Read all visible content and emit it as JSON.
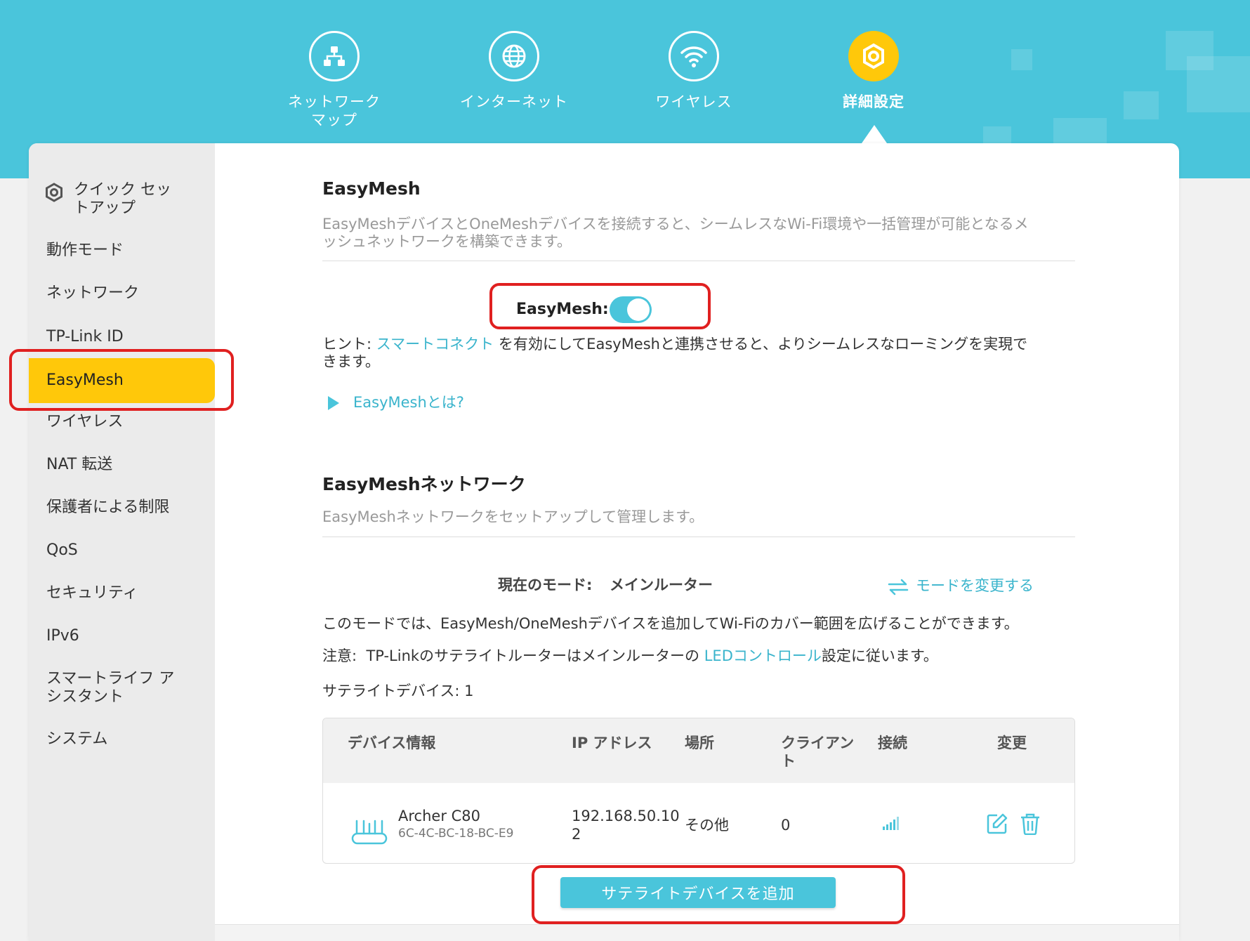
{
  "header": {
    "nav": [
      {
        "label_1": "ネットワーク",
        "label_2": "マップ",
        "icon": "network-map-icon",
        "active": false
      },
      {
        "label_1": "インターネット",
        "label_2": "",
        "icon": "globe-icon",
        "active": false
      },
      {
        "label_1": "ワイヤレス",
        "label_2": "",
        "icon": "wifi-icon",
        "active": false
      },
      {
        "label_1": "詳細設定",
        "label_2": "",
        "icon": "gear-icon",
        "active": true
      }
    ]
  },
  "sidebar": {
    "quick_setup_1": "クイック セッ",
    "quick_setup_2": "トアップ",
    "items": [
      "動作モード",
      "ネットワーク",
      "TP-Link ID",
      "EasyMesh",
      "ワイヤレス",
      "NAT 転送",
      "保護者による制限",
      "QoS",
      "セキュリティ",
      "IPv6",
      "スマートライフ ア",
      "シスタント",
      "システム"
    ]
  },
  "easymesh": {
    "title": "EasyMesh",
    "desc_1": "EasyMeshデバイスとOneMeshデバイスを接続すると、シームレスなWi-Fi環境や一括管理が可能となるメ",
    "desc_2": "ッシュネットワークを構築できます。",
    "toggle_label": "EasyMesh:",
    "toggle_on": true,
    "hint_prefix": "ヒント: ",
    "hint_link": "スマートコネクト",
    "hint_suffix": " を有効にしてEasyMeshと連携させると、よりシームレスなローミングを実現で",
    "hint_line2": "きます。",
    "what_is": "EasyMeshとは?"
  },
  "network": {
    "title": "EasyMeshネットワーク",
    "desc": "EasyMeshネットワークをセットアップして管理します。",
    "mode_label": "現在のモード:",
    "mode_value": "メインルーター",
    "change_mode": "モードを変更する",
    "mode_desc": "このモードでは、EasyMesh/OneMeshデバイスを追加してWi-Fiのカバー範囲を広げることができます。",
    "note_label": "注意:",
    "note_prefix": "TP-Linkのサテライトルーターはメインルーターの ",
    "note_link": "LEDコントロール",
    "note_suffix": "設定に従います。",
    "satellite_count": "サテライトデバイス: 1",
    "table": {
      "headers": [
        "デバイス情報",
        "IP アドレス",
        "場所",
        "クライアン",
        "ト",
        "接続",
        "変更"
      ],
      "rows": [
        {
          "name": "Archer C80",
          "mac": "6C-4C-BC-18-BC-E9",
          "ip_1": "192.168.50.10",
          "ip_2": "2",
          "location": "その他",
          "clients": "0"
        }
      ]
    },
    "add_button": "サテライトデバイスを追加"
  },
  "colors": {
    "accent": "#4ac5db",
    "active": "#ffc80a",
    "highlight": "#e02020"
  }
}
